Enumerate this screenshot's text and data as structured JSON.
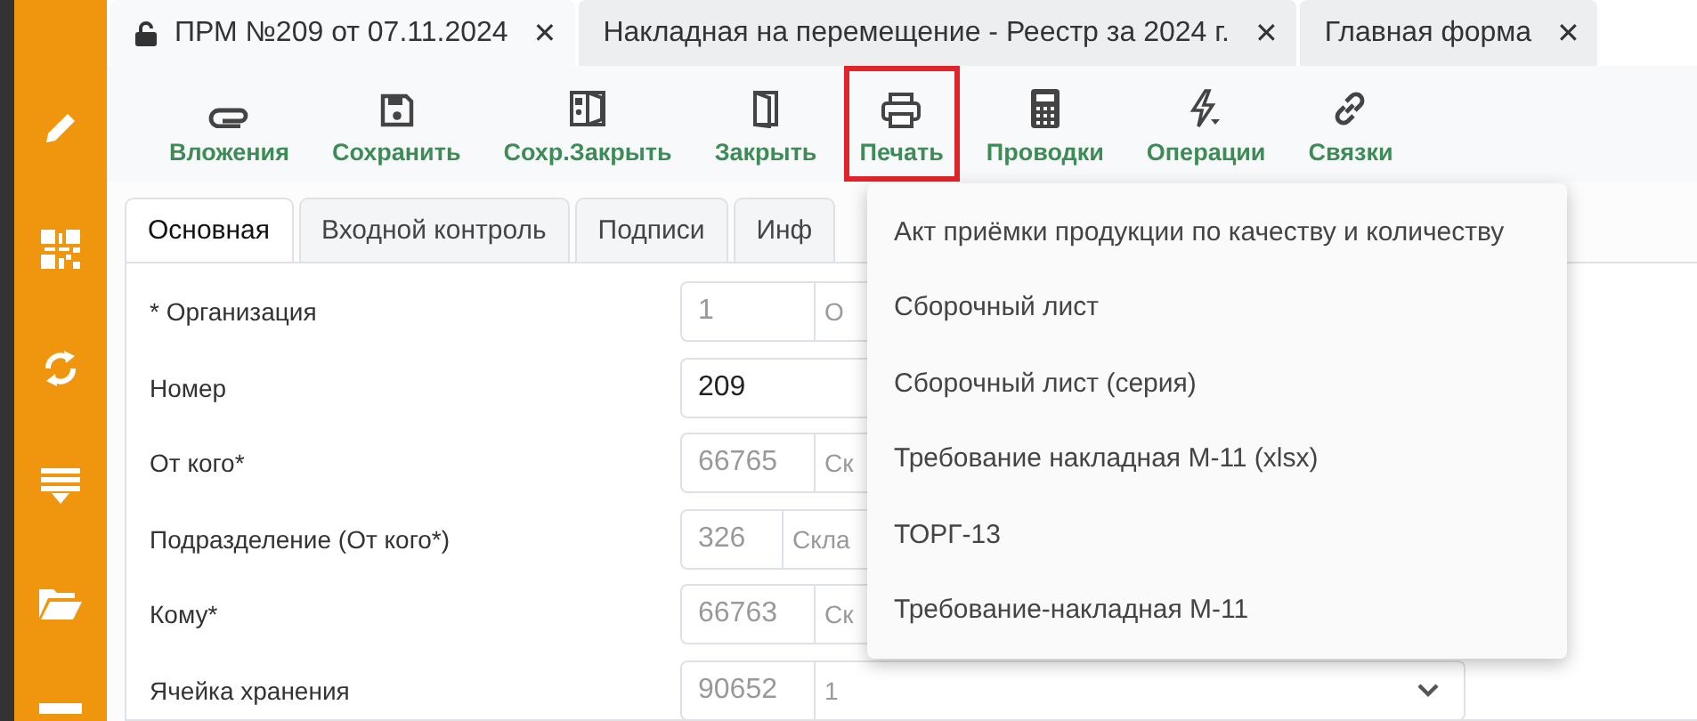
{
  "sidebar": {
    "items": [
      {
        "kind": "edit"
      },
      {
        "kind": "qr"
      },
      {
        "kind": "sync"
      },
      {
        "kind": "list"
      },
      {
        "kind": "folder"
      },
      {
        "kind": "panel"
      }
    ]
  },
  "document_tabs": [
    {
      "label": "ПРМ №209 от 07.11.2024",
      "close": "✕",
      "locked": true,
      "selected": true
    },
    {
      "label": "Накладная на перемещение - Реестр за 2024 г.",
      "close": "✕",
      "locked": false,
      "selected": false
    },
    {
      "label": "Главная форма",
      "close": "✕",
      "locked": false,
      "selected": false
    }
  ],
  "toolbar": [
    {
      "label": "Вложения",
      "kind": "attach",
      "highlighted": false
    },
    {
      "label": "Сохранить",
      "kind": "save",
      "highlighted": false
    },
    {
      "label": "Сохр.Закрыть",
      "kind": "saveclose",
      "highlighted": false
    },
    {
      "label": "Закрыть",
      "kind": "close",
      "highlighted": false
    },
    {
      "label": "Печать",
      "kind": "print",
      "highlighted": true
    },
    {
      "label": "Проводки",
      "kind": "calc",
      "highlighted": false
    },
    {
      "label": "Операции",
      "kind": "bolt",
      "highlighted": false
    },
    {
      "label": "Связки",
      "kind": "link",
      "highlighted": false
    }
  ],
  "form_tabs": [
    {
      "label": "Основная",
      "selected": true
    },
    {
      "label": "Входной контроль",
      "selected": false
    },
    {
      "label": "Подписи",
      "selected": false
    },
    {
      "label": "Инф",
      "selected": false
    }
  ],
  "fields": [
    {
      "kind": "lookup",
      "label": "* Организация",
      "code": "1",
      "name": "О"
    },
    {
      "kind": "text",
      "label": "Номер",
      "value": "209"
    },
    {
      "kind": "lookup",
      "label": "От кого*",
      "code": "66765",
      "name": "Ск"
    },
    {
      "kind": "lookup-short",
      "label": "Подразделение (От кого*)",
      "code": "326",
      "name": "Скла"
    },
    {
      "kind": "lookup",
      "label": "Кому*",
      "code": "66763",
      "name": "Ск"
    },
    {
      "kind": "select",
      "label": "Ячейка хранения",
      "code": "90652",
      "name": "1"
    }
  ],
  "print_menu": {
    "items": [
      "Акт приёмки продукции по качеству и количеству",
      "Сборочный лист",
      "Сборочный лист (серия)",
      "Требование накладная М-11 (xlsx)",
      "ТОРГ-13",
      "Требование-накладная М-11"
    ]
  }
}
